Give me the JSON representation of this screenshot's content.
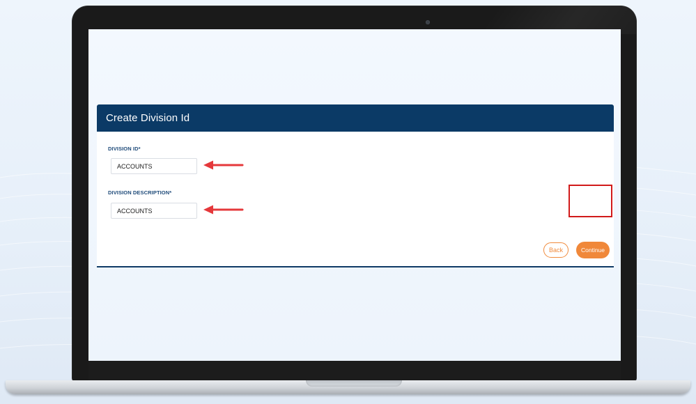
{
  "form": {
    "title": "Create Division Id",
    "fields": [
      {
        "label": "DIVISION ID*",
        "value": "ACCOUNTS"
      },
      {
        "label": "DIVISION DESCRIPTION*",
        "value": "ACCOUNTS"
      }
    ],
    "back_label": "Back",
    "continue_label": "Continue"
  },
  "colors": {
    "header": "#0b3a66",
    "accent": "#f0883a",
    "highlight": "#d11a1a",
    "arrow": "#e5383b"
  },
  "icons": {
    "arrow": "left-arrow-icon",
    "camera": "camera-icon"
  }
}
